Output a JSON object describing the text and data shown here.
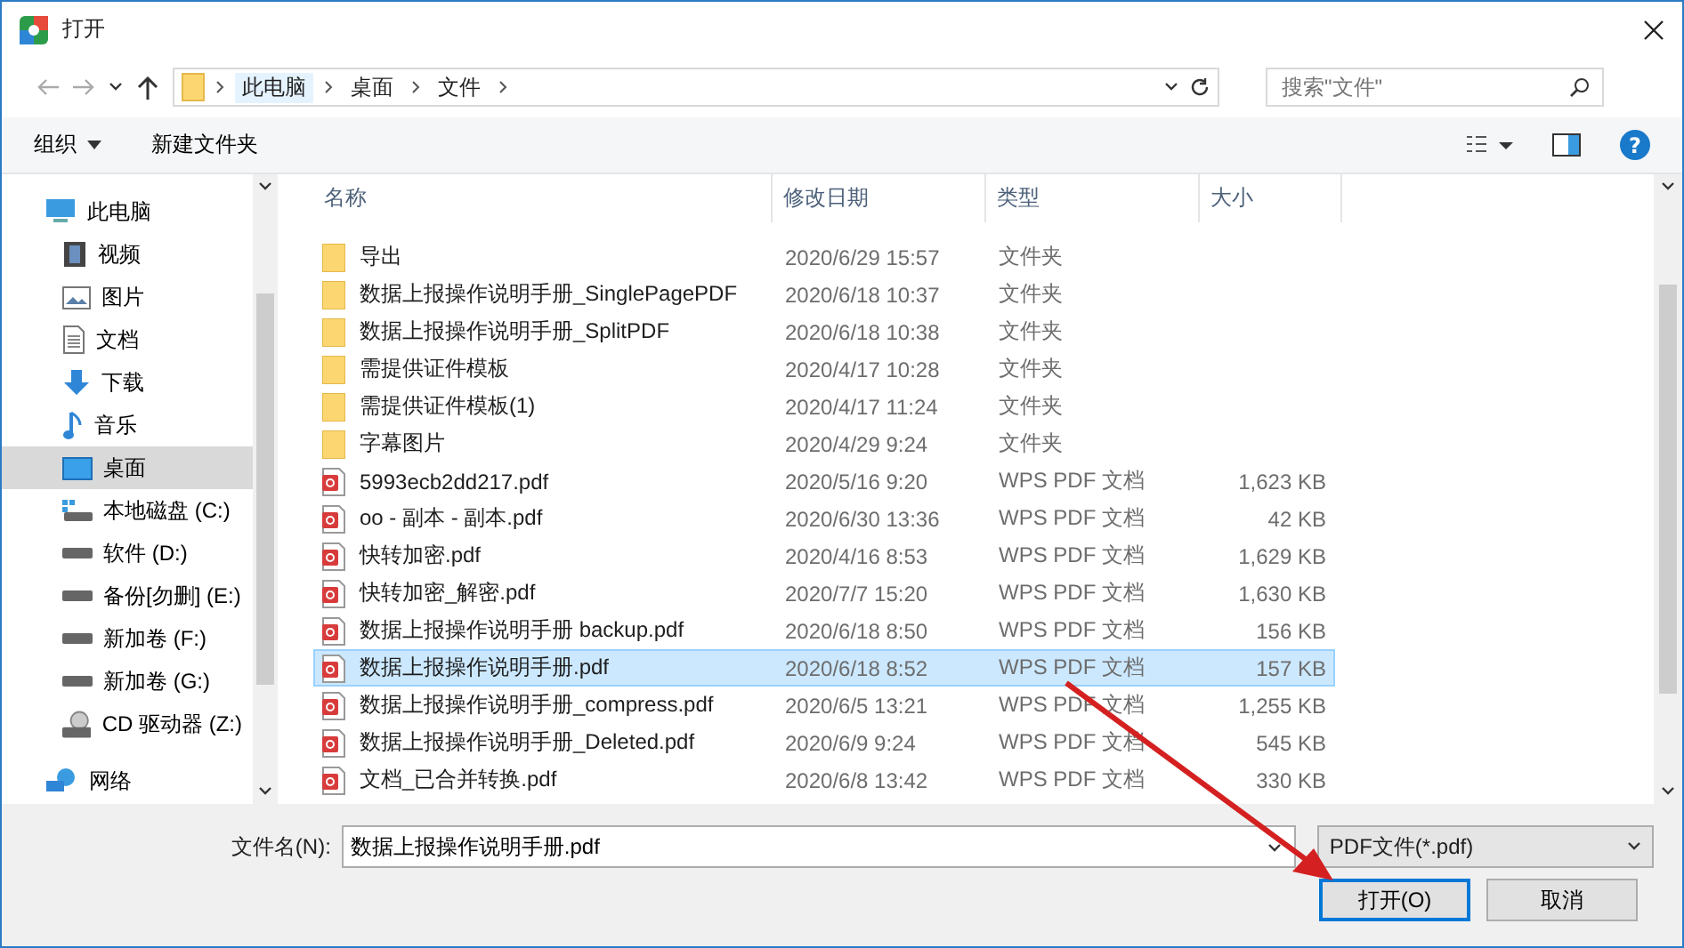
{
  "window": {
    "title": "打开"
  },
  "address_bar": {
    "path": [
      "此电脑",
      "桌面",
      "文件"
    ]
  },
  "search": {
    "placeholder": "搜索\"文件\""
  },
  "toolbar": {
    "organize": "组织",
    "new_folder": "新建文件夹",
    "help": "?"
  },
  "sidebar": {
    "items": [
      {
        "label": "此电脑",
        "kind": "pc",
        "selected": false,
        "children": [
          {
            "label": "视频",
            "kind": "video",
            "selected": false
          },
          {
            "label": "图片",
            "kind": "picture",
            "selected": false
          },
          {
            "label": "文档",
            "kind": "document",
            "selected": false
          },
          {
            "label": "下载",
            "kind": "download",
            "selected": false
          },
          {
            "label": "音乐",
            "kind": "music",
            "selected": false
          },
          {
            "label": "桌面",
            "kind": "desktop",
            "selected": true
          },
          {
            "label": "本地磁盘 (C:)",
            "kind": "system-drive",
            "selected": false
          },
          {
            "label": "软件 (D:)",
            "kind": "drive",
            "selected": false
          },
          {
            "label": "备份[勿删] (E:)",
            "kind": "drive",
            "selected": false
          },
          {
            "label": "新加卷 (F:)",
            "kind": "drive",
            "selected": false
          },
          {
            "label": "新加卷 (G:)",
            "kind": "drive",
            "selected": false
          },
          {
            "label": "CD 驱动器 (Z:)",
            "kind": "cd",
            "selected": false
          }
        ]
      },
      {
        "label": "网络",
        "kind": "network",
        "selected": false
      }
    ]
  },
  "table": {
    "columns": [
      "名称",
      "修改日期",
      "类型",
      "大小"
    ],
    "rows": [
      {
        "kind": "folder",
        "name": "导出",
        "date": "2020/6/29 15:57",
        "type": "文件夹",
        "selected": false
      },
      {
        "kind": "folder",
        "name": "数据上报操作说明手册_SinglePagePDF",
        "date": "2020/6/18 10:37",
        "type": "文件夹",
        "selected": false
      },
      {
        "kind": "folder",
        "name": "数据上报操作说明手册_SplitPDF",
        "date": "2020/6/18 10:38",
        "type": "文件夹",
        "selected": false
      },
      {
        "kind": "folder",
        "name": "需提供证件模板",
        "date": "2020/4/17 10:28",
        "type": "文件夹",
        "selected": false
      },
      {
        "kind": "folder",
        "name": "需提供证件模板(1)",
        "date": "2020/4/17 11:24",
        "type": "文件夹",
        "selected": false
      },
      {
        "kind": "folder",
        "name": "字幕图片",
        "date": "2020/4/29 9:24",
        "type": "文件夹",
        "selected": false
      },
      {
        "kind": "pdf",
        "name": "5993ecb2dd217.pdf",
        "date": "2020/5/16 9:20",
        "type": "WPS PDF 文档",
        "size": "1,623 KB",
        "selected": false
      },
      {
        "kind": "pdf",
        "name": "oo - 副本 - 副本.pdf",
        "date": "2020/6/30 13:36",
        "type": "WPS PDF 文档",
        "size": "42 KB",
        "selected": false
      },
      {
        "kind": "pdf",
        "name": "快转加密.pdf",
        "date": "2020/4/16 8:53",
        "type": "WPS PDF 文档",
        "size": "1,629 KB",
        "selected": false
      },
      {
        "kind": "pdf",
        "name": "快转加密_解密.pdf",
        "date": "2020/7/7 15:20",
        "type": "WPS PDF 文档",
        "size": "1,630 KB",
        "selected": false
      },
      {
        "kind": "pdf",
        "name": "数据上报操作说明手册 backup.pdf",
        "date": "2020/6/18 8:50",
        "type": "WPS PDF 文档",
        "size": "156 KB",
        "selected": false
      },
      {
        "kind": "pdf",
        "name": "数据上报操作说明手册.pdf",
        "date": "2020/6/18 8:52",
        "type": "WPS PDF 文档",
        "size": "157 KB",
        "selected": true
      },
      {
        "kind": "pdf",
        "name": "数据上报操作说明手册_compress.pdf",
        "date": "2020/6/5 13:21",
        "type": "WPS PDF 文档",
        "size": "1,255 KB",
        "selected": false
      },
      {
        "kind": "pdf",
        "name": "数据上报操作说明手册_Deleted.pdf",
        "date": "2020/6/9 9:24",
        "type": "WPS PDF 文档",
        "size": "545 KB",
        "selected": false
      },
      {
        "kind": "pdf",
        "name": "文档_已合并转换.pdf",
        "date": "2020/6/8 13:42",
        "type": "WPS PDF 文档",
        "size": "330 KB",
        "selected": false
      }
    ]
  },
  "footer": {
    "filename_label": "文件名(N):",
    "filename": "数据上报操作说明手册.pdf",
    "filetype": "PDF文件(*.pdf)",
    "buttons": [
      "打开(O)",
      "取消"
    ]
  }
}
